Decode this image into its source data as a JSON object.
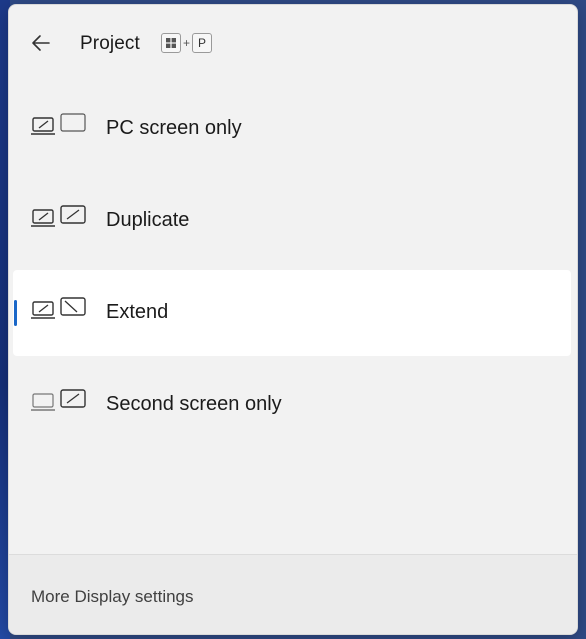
{
  "header": {
    "title": "Project",
    "back_icon": "arrow-left-icon",
    "shortcut": {
      "win_key_icon": "windows-key-icon",
      "plus": "+",
      "key": "P"
    }
  },
  "options": [
    {
      "label": "PC screen only",
      "icon": "pc-screen-only-icon",
      "selected": false
    },
    {
      "label": "Duplicate",
      "icon": "duplicate-icon",
      "selected": false
    },
    {
      "label": "Extend",
      "icon": "extend-icon",
      "selected": true
    },
    {
      "label": "Second screen only",
      "icon": "second-screen-only-icon",
      "selected": false
    }
  ],
  "footer": {
    "link_label": "More Display settings"
  },
  "colors": {
    "accent": "#1a67c8",
    "panel_bg": "#f2f2f2",
    "selected_bg": "#ffffff"
  }
}
